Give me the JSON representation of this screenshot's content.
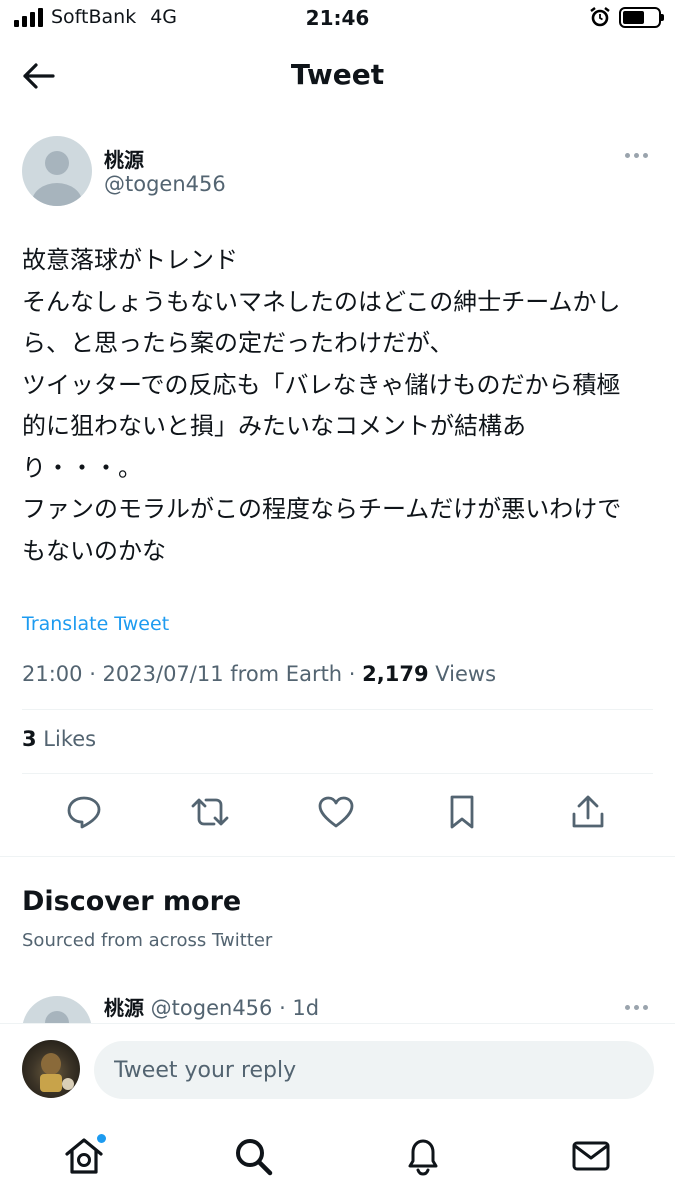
{
  "status_bar": {
    "carrier": "SoftBank",
    "network": "4G",
    "time": "21:46"
  },
  "header": {
    "title": "Tweet"
  },
  "tweet": {
    "author_name": "桃源",
    "author_handle": "@togen456",
    "lines": [
      "故意落球がトレンド",
      "そんなしょうもないマネしたのはどこの紳士チームかし",
      "ら、と思ったら案の定だったわけだが、",
      "ツイッターでの反応も「バレなきゃ儲けものだから積極",
      "的に狙わないと損」みたいなコメントが結構あ",
      "り・・・。",
      "ファンのモラルがこの程度ならチームだけが悪いわけで",
      "もないのかな"
    ],
    "translate_label": "Translate Tweet",
    "timestamp": "21:00 · 2023/07/11 from Earth · ",
    "views_count": "2,179",
    "views_label": " Views",
    "likes_count": "3",
    "likes_label": " Likes"
  },
  "discover": {
    "title": "Discover more",
    "subtitle": "Sourced from across Twitter",
    "related_tweet": {
      "author_name": "桃源",
      "author_handle": " @togen456 · 1d"
    }
  },
  "reply": {
    "placeholder": "Tweet your reply"
  },
  "colors": {
    "accent": "#1d9bf0",
    "secondary_text": "#536471",
    "primary_text": "#0f1419"
  },
  "icons": {
    "back": "arrow-left-icon",
    "reply": "comment-icon",
    "retweet": "retweet-icon",
    "like": "heart-icon",
    "bookmark": "bookmark-icon",
    "share": "share-icon",
    "home": "home-icon",
    "search": "search-icon",
    "notifications": "bell-icon",
    "messages": "mail-icon"
  }
}
